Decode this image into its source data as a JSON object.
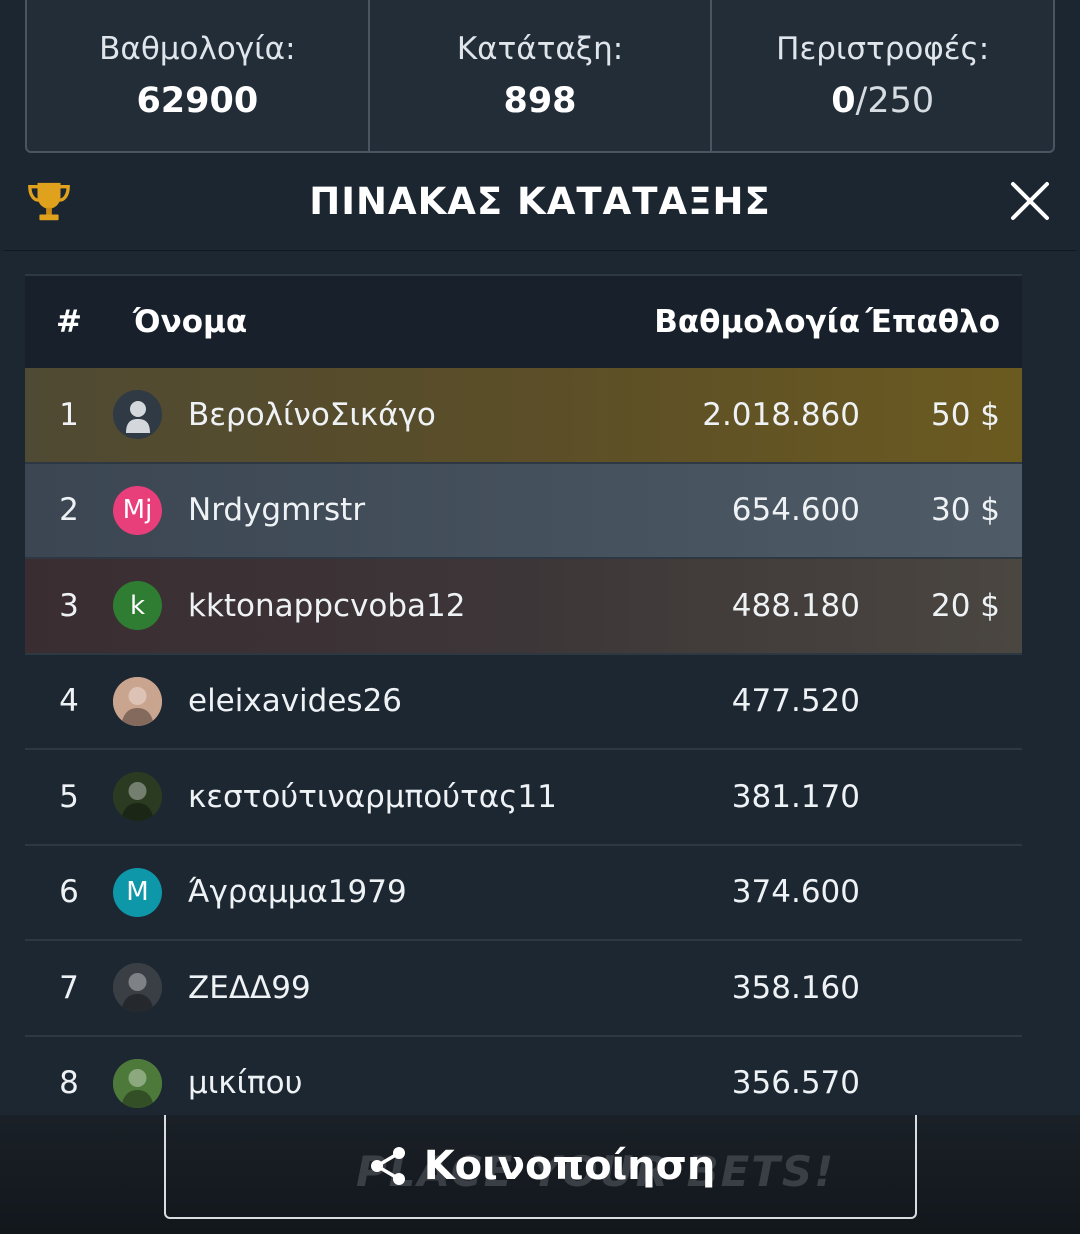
{
  "stats": {
    "score_label": "Βαθμολογία:",
    "score_value": "62900",
    "rank_label": "Κατάταξη:",
    "rank_value": "898",
    "spins_label": "Περιστροφές:",
    "spins_used": "0",
    "spins_total": "/250"
  },
  "header": {
    "title": "ΠΙΝΑΚΑΣ ΚΑΤΑΤΑΞΗΣ",
    "trophy_icon": "trophy-icon",
    "close_icon": "close-icon"
  },
  "table": {
    "columns": {
      "rank": "#",
      "name": "Όνομα",
      "score": "Βαθμολογία",
      "prize": "Έπαθλο"
    },
    "rows": [
      {
        "rank": "1",
        "name": "ΒερολίνοΣικάγο",
        "score": "2.018.860",
        "prize": "50 $",
        "avatar_text": "",
        "avatar_kind": "default-user",
        "avatar_color": "#2f3a44"
      },
      {
        "rank": "2",
        "name": "Nrdygmrstr",
        "score": "654.600",
        "prize": "30 $",
        "avatar_text": "Mj",
        "avatar_kind": "initials",
        "avatar_color": "#e83e7a"
      },
      {
        "rank": "3",
        "name": "kktonappcvoba12",
        "score": "488.180",
        "prize": "20 $",
        "avatar_text": "k",
        "avatar_kind": "initials",
        "avatar_color": "#2e7d32"
      },
      {
        "rank": "4",
        "name": "eleixavides26",
        "score": "477.520",
        "prize": "",
        "avatar_text": "",
        "avatar_kind": "photo",
        "avatar_color": "#c9a48f"
      },
      {
        "rank": "5",
        "name": "κεστούτιναρμπούτας11",
        "score": "381.170",
        "prize": "",
        "avatar_text": "",
        "avatar_kind": "photo",
        "avatar_color": "#2a3b22"
      },
      {
        "rank": "6",
        "name": "Άγραμμα1979",
        "score": "374.600",
        "prize": "",
        "avatar_text": "M",
        "avatar_kind": "initials",
        "avatar_color": "#0e97a8"
      },
      {
        "rank": "7",
        "name": "ΖΕΔΔ99",
        "score": "358.160",
        "prize": "",
        "avatar_text": "",
        "avatar_kind": "photo",
        "avatar_color": "#3a3f45"
      },
      {
        "rank": "8",
        "name": "μικίπου",
        "score": "356.570",
        "prize": "",
        "avatar_text": "",
        "avatar_kind": "photo",
        "avatar_color": "#4d7a3a"
      }
    ]
  },
  "footer": {
    "share_label": "Κοινοποίηση",
    "share_icon": "share-icon",
    "background_text": "PLACE YOUR BETS!"
  },
  "colors": {
    "background": "#1c2630",
    "gold_row": "#6b5a20",
    "silver_row": "#4f5b67",
    "bronze_row": "#3a2d32",
    "trophy": "#e0a21c"
  }
}
